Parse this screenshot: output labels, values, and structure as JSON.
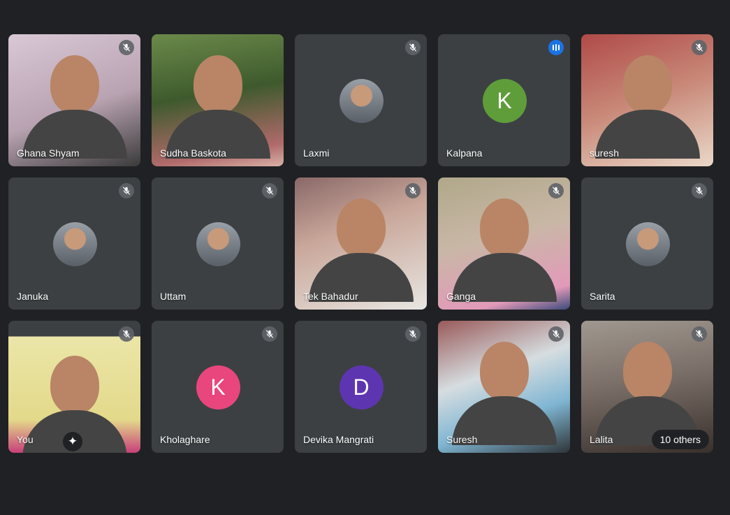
{
  "participants": [
    {
      "name": "Ghana Shyam",
      "kind": "video",
      "tone": 0,
      "mic": "muted"
    },
    {
      "name": "Sudha Baskota",
      "kind": "video",
      "tone": 1,
      "mic": "none"
    },
    {
      "name": "Laxmi",
      "kind": "photo",
      "mic": "muted"
    },
    {
      "name": "Kalpana",
      "kind": "initial",
      "initial": "K",
      "color": "#5f9d3a",
      "mic": "speaking"
    },
    {
      "name": "suresh",
      "kind": "video",
      "tone": 2,
      "mic": "muted"
    },
    {
      "name": "Januka",
      "kind": "photo",
      "mic": "muted"
    },
    {
      "name": "Uttam",
      "kind": "photo",
      "mic": "muted"
    },
    {
      "name": "Tek Bahadur",
      "kind": "video",
      "tone": 3,
      "mic": "muted"
    },
    {
      "name": "Ganga",
      "kind": "video",
      "tone": 4,
      "mic": "muted"
    },
    {
      "name": "Sarita",
      "kind": "photo",
      "mic": "muted"
    },
    {
      "name": "You",
      "kind": "video",
      "tone": 5,
      "mic": "muted",
      "effects": true
    },
    {
      "name": "Kholaghare",
      "kind": "initial",
      "initial": "K",
      "color": "#e8467c",
      "mic": "muted"
    },
    {
      "name": "Devika Mangrati",
      "kind": "initial",
      "initial": "D",
      "color": "#5e35b1",
      "mic": "muted"
    },
    {
      "name": "Suresh",
      "kind": "video",
      "tone": 6,
      "mic": "muted"
    },
    {
      "name": "Lalita",
      "kind": "video",
      "tone": 7,
      "mic": "muted",
      "others": "10 others"
    }
  ]
}
